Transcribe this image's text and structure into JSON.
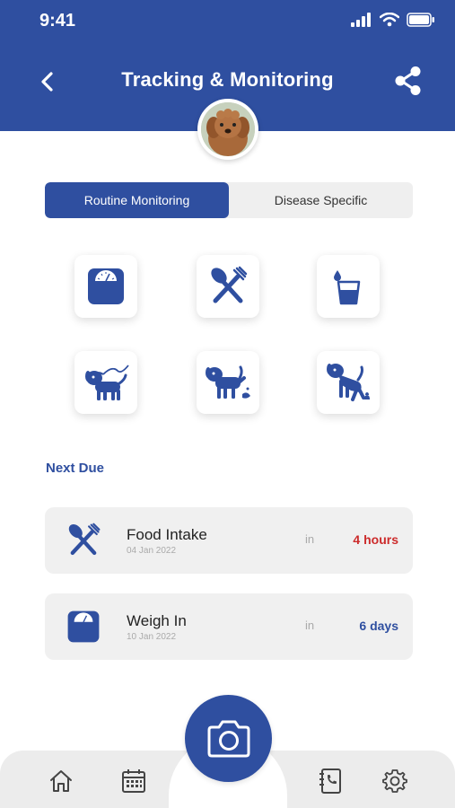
{
  "status_bar": {
    "time": "9:41"
  },
  "header": {
    "title": "Tracking & Monitoring"
  },
  "tabs": [
    {
      "label": "Routine Monitoring",
      "active": true
    },
    {
      "label": "Disease Specific",
      "active": false
    }
  ],
  "tracking_items": [
    {
      "name": "weight",
      "icon": "weighing-scale-icon"
    },
    {
      "name": "food",
      "icon": "fork-knife-icon"
    },
    {
      "name": "water",
      "icon": "water-glass-icon"
    },
    {
      "name": "walk",
      "icon": "dog-leash-icon"
    },
    {
      "name": "urine",
      "icon": "dog-pee-icon"
    },
    {
      "name": "stool",
      "icon": "dog-poop-icon"
    }
  ],
  "next_due": {
    "heading": "Next Due",
    "items": [
      {
        "title": "Food Intake",
        "date": "04 Jan 2022",
        "in_label": "in",
        "eta": "4 hours",
        "eta_color": "#cc2b2b",
        "icon": "fork-knife-icon"
      },
      {
        "title": "Weigh In",
        "date": "10 Jan 2022",
        "in_label": "in",
        "eta": "6 days",
        "eta_color": "#2f4fa0",
        "icon": "weighing-scale-icon"
      }
    ]
  },
  "bottom_nav": [
    "home-icon",
    "calendar-icon",
    "camera-icon",
    "phone-book-icon",
    "settings-icon"
  ],
  "colors": {
    "primary": "#2f4fa0",
    "alert": "#cc2b2b",
    "card_bg": "#f0f0f0"
  }
}
